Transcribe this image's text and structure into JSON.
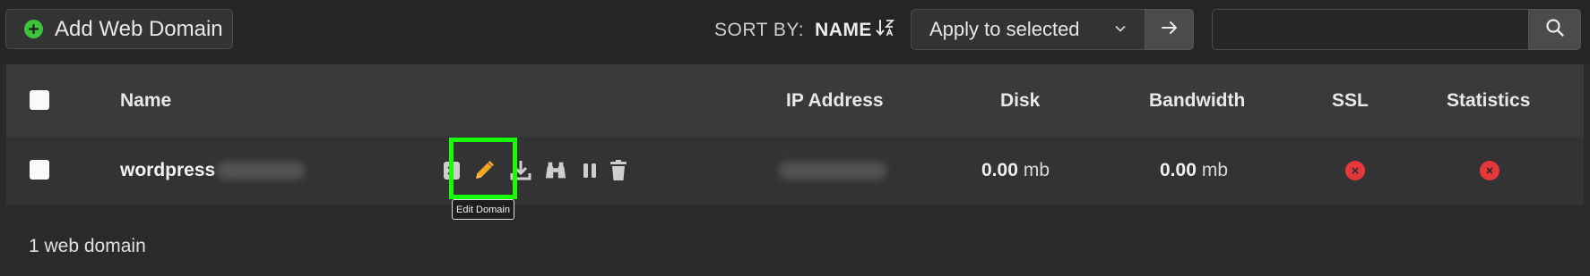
{
  "toolbar": {
    "add_label": "Add Web Domain",
    "sort_by_label": "SORT BY:",
    "sort_value": "NAME",
    "apply_label": "Apply to selected",
    "search_value": ""
  },
  "table": {
    "headers": {
      "name": "Name",
      "ip": "IP Address",
      "disk": "Disk",
      "bandwidth": "Bandwidth",
      "ssl": "SSL",
      "statistics": "Statistics"
    },
    "rows": [
      {
        "name": "wordpress",
        "disk_value": "0.00",
        "disk_unit": "mb",
        "bandwidth_value": "0.00",
        "bandwidth_unit": "mb",
        "ssl_enabled": false,
        "statistics_enabled": false
      }
    ]
  },
  "tooltip": "Edit Domain",
  "footer": {
    "count_label": "1 web domain"
  },
  "colors": {
    "add_icon": "#3ec33e",
    "edit_icon": "#f5a623",
    "status_off": "#e5383b",
    "highlight": "#15ff00"
  }
}
